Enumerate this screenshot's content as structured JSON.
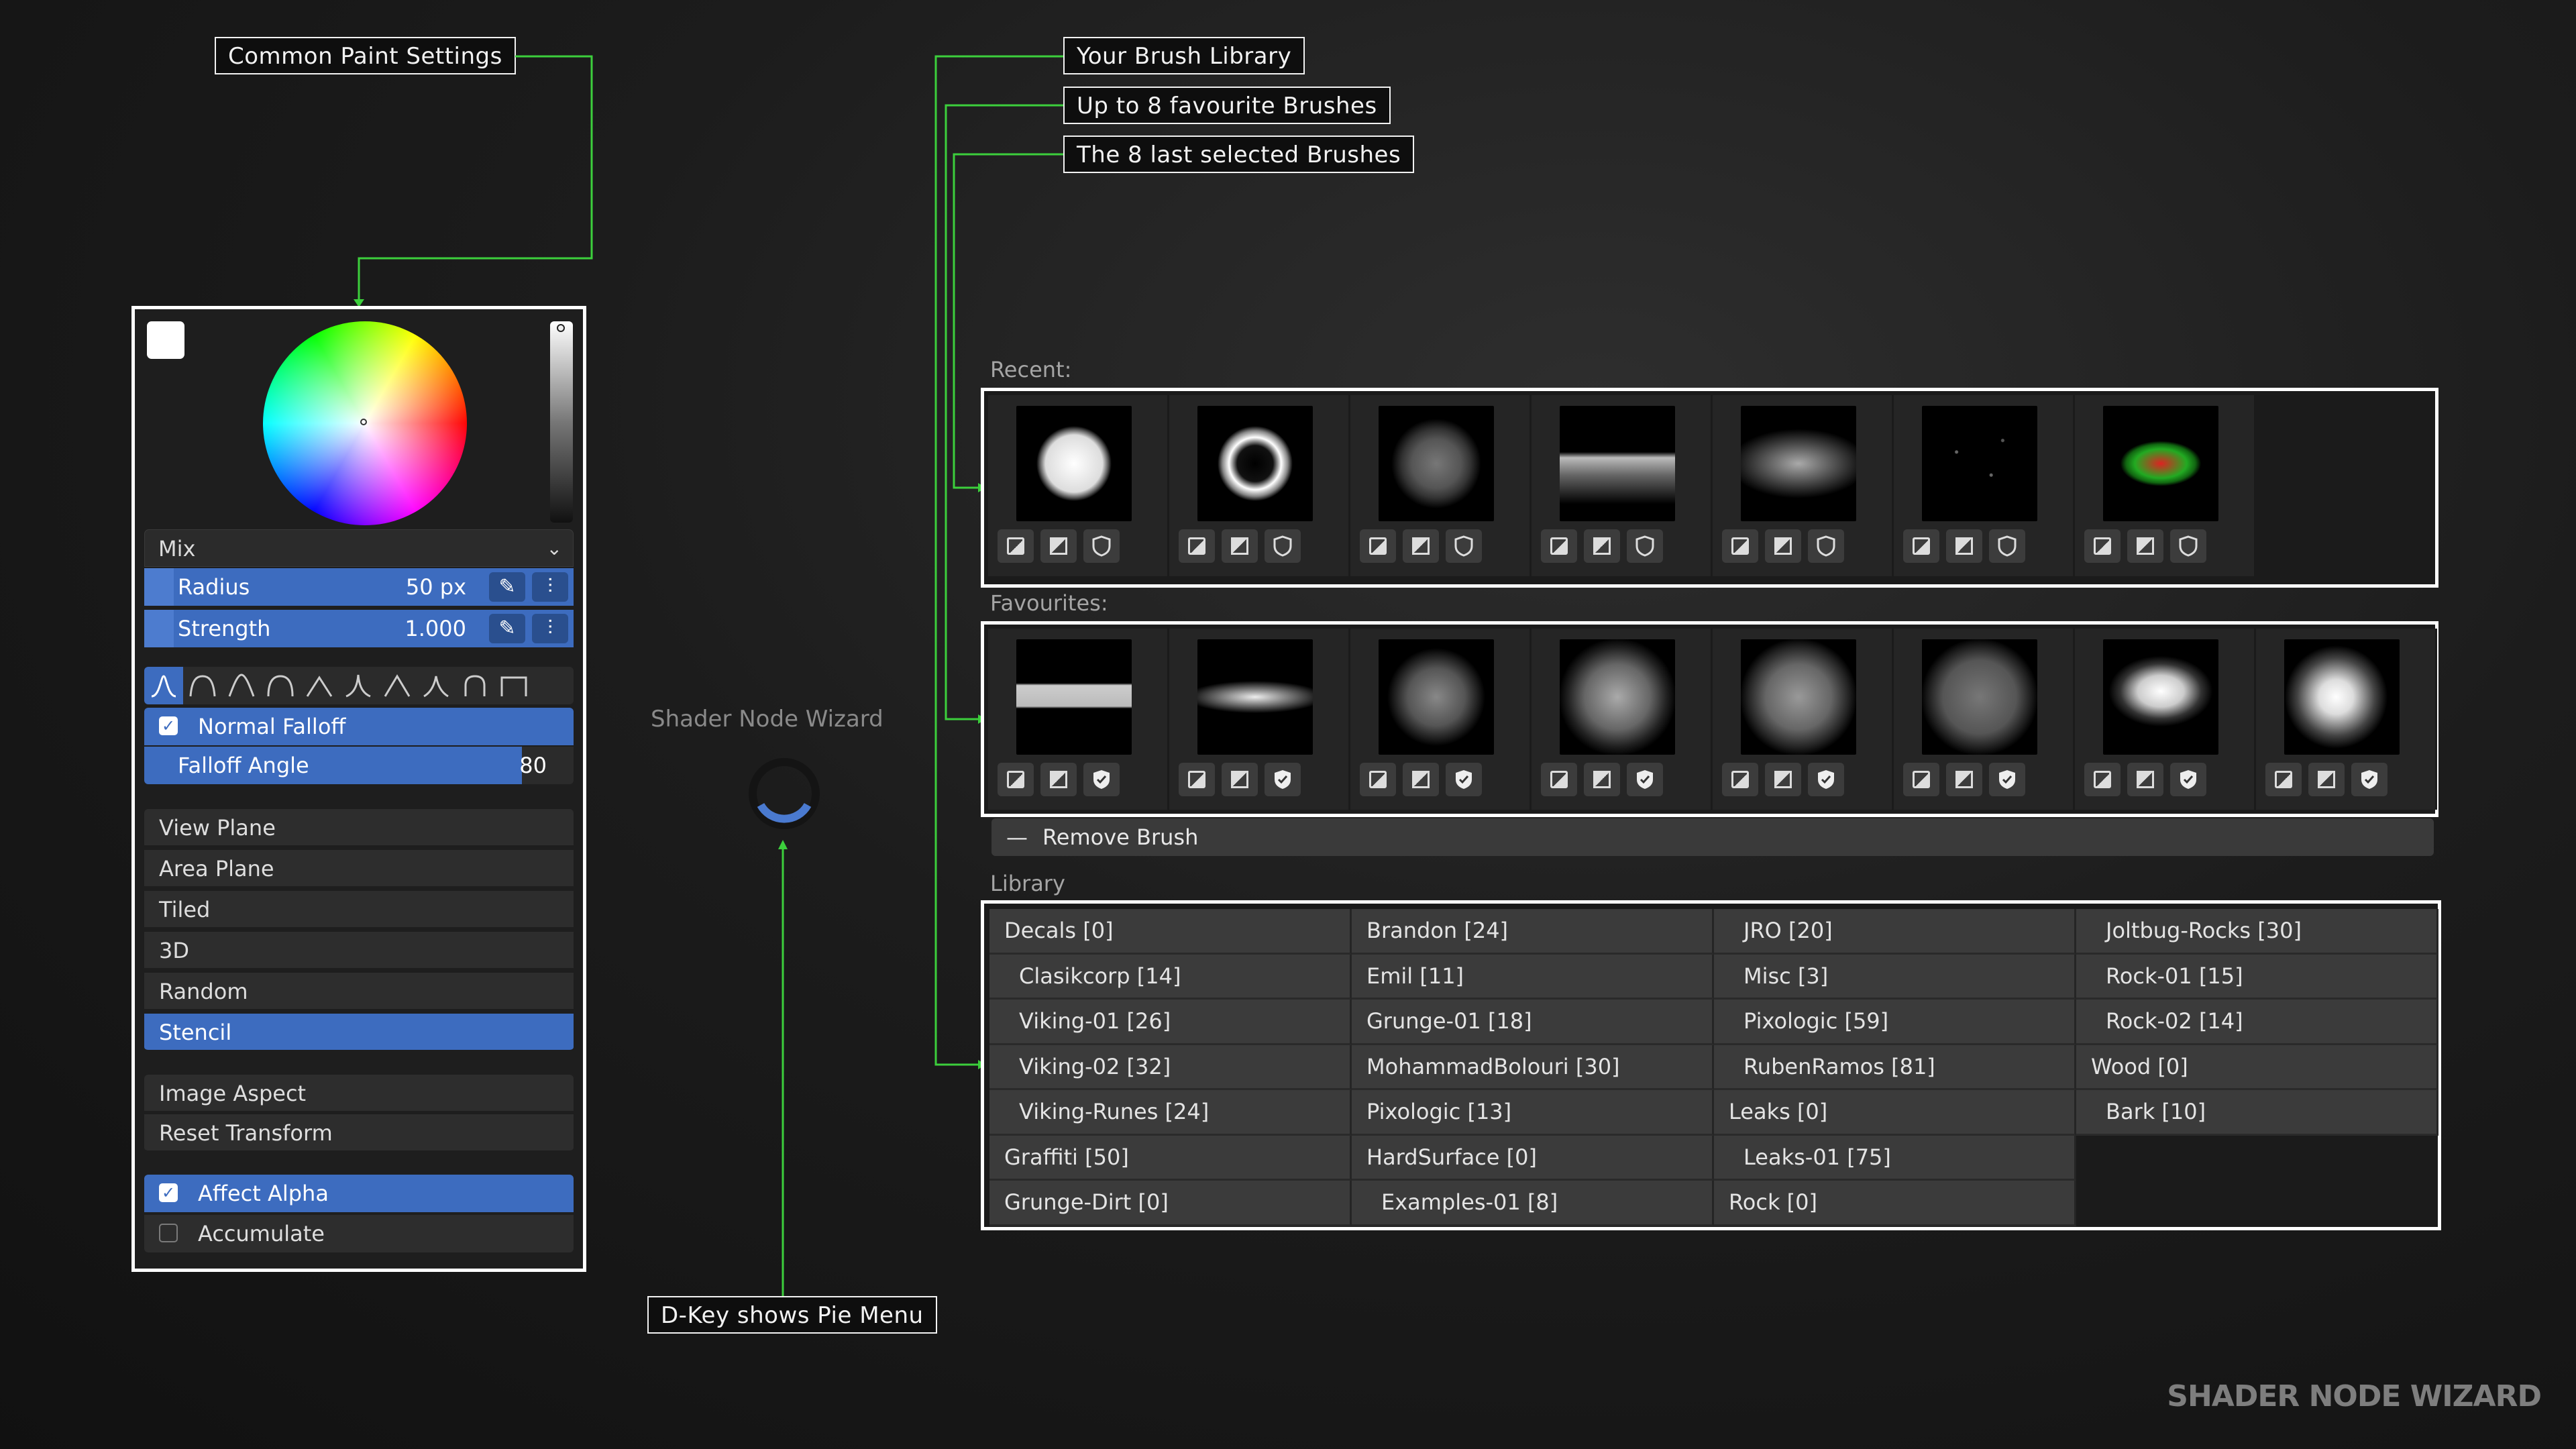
{
  "annotations": {
    "common_paint": "Common Paint Settings",
    "brush_library": "Your Brush Library",
    "favourites": "Up to 8 favourite Brushes",
    "recent": "The 8 last selected Brushes",
    "pie_menu": "D-Key shows Pie Menu"
  },
  "paint": {
    "blend": "Mix",
    "radius_label": "Radius",
    "radius_value": "50 px",
    "strength_label": "Strength",
    "strength_value": "1.000",
    "normal_falloff": "Normal Falloff",
    "falloff_angle_label": "Falloff Angle",
    "falloff_angle_value": "80",
    "mapping": [
      "View Plane",
      "Area Plane",
      "Tiled",
      "3D",
      "Random",
      "Stencil"
    ],
    "selected_mapping": "Stencil",
    "stencil_actions": [
      "Image Aspect",
      "Reset Transform"
    ],
    "affect_alpha": "Affect Alpha",
    "affect_alpha_checked": true,
    "accumulate": "Accumulate",
    "accumulate_checked": false,
    "normal_falloff_checked": true
  },
  "pie": {
    "label": "Shader Node Wizard"
  },
  "brushes": {
    "recent_label": "Recent:",
    "favourites_label": "Favourites:",
    "remove_label": "Remove Brush",
    "library_label": "Library",
    "library": [
      [
        "Decals [0]",
        "Brandon [24]",
        "JRO [20]",
        "Joltbug-Rocks [30]"
      ],
      [
        "Clasikcorp [14]",
        "Emil [11]",
        "Misc [3]",
        "Rock-01 [15]"
      ],
      [
        "Viking-01 [26]",
        "Grunge-01 [18]",
        "Pixologic [59]",
        "Rock-02 [14]"
      ],
      [
        "Viking-02 [32]",
        "MohammadBolouri [30]",
        "RubenRamos [81]",
        "Wood [0]"
      ],
      [
        "Viking-Runes [24]",
        "Pixologic [13]",
        "Leaks [0]",
        "Bark [10]"
      ],
      [
        "Graffiti [50]",
        "HardSurface [0]",
        "Leaks-01 [75]",
        ""
      ],
      [
        "Grunge-Dirt [0]",
        "Examples-01 [8]",
        "Rock [0]",
        ""
      ]
    ]
  },
  "watermark": "SHADER NODE WIZARD",
  "colors": {
    "accent": "#3d6cbf",
    "connector": "#3ccf3c"
  }
}
